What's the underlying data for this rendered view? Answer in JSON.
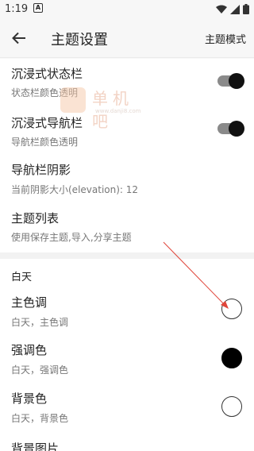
{
  "status_bar": {
    "time": "1:19",
    "notif_badge": "A"
  },
  "app_bar": {
    "title": "主题设置",
    "action_label": "主题模式"
  },
  "settings": {
    "immersive_status": {
      "title": "沉浸式状态栏",
      "subtitle": "状态栏颜色透明",
      "enabled": true
    },
    "immersive_nav": {
      "title": "沉浸式导航栏",
      "subtitle": "导航栏颜色透明",
      "enabled": true
    },
    "nav_shadow": {
      "title": "导航栏阴影",
      "subtitle": "当前阴影大小(elevation): 12"
    },
    "theme_list": {
      "title": "主题列表",
      "subtitle": "使用保存主题,导入,分享主题"
    }
  },
  "day_section": {
    "header": "白天",
    "items": [
      {
        "title": "主色调",
        "subtitle": "白天，主色调",
        "color": "#ffffff"
      },
      {
        "title": "强调色",
        "subtitle": "白天，强调色",
        "color": "#000000"
      },
      {
        "title": "背景色",
        "subtitle": "白天，背景色",
        "color": "#ffffff"
      },
      {
        "title": "背景图片"
      }
    ]
  },
  "watermark": {
    "text": "单机吧",
    "url": "www.danji8.com"
  },
  "annotation_color": "#e0453a"
}
